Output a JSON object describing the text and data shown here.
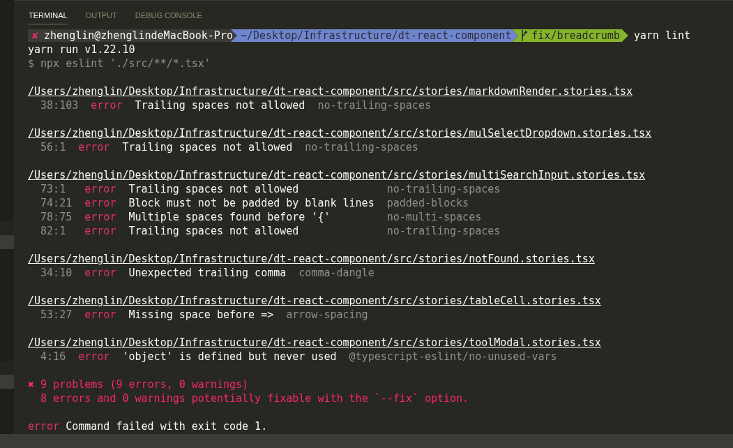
{
  "tabs": [
    {
      "label": "TERMINAL",
      "selected": true
    },
    {
      "label": "OUTPUT",
      "selected": false
    },
    {
      "label": "DEBUG CONSOLE",
      "selected": false
    }
  ],
  "prompt": {
    "status": "✘",
    "user": "zhenglin@zhenglindeMacBook-Pro",
    "path": "~/Desktop/Infrastructure/dt-react-component",
    "branch": "fix/breadcrumb",
    "command": "yarn lint"
  },
  "lines": [
    {
      "kind": "plain",
      "text": "yarn run v1.22.10"
    },
    {
      "kind": "dim",
      "text": "$ npx eslint './src/**/*.tsx'"
    }
  ],
  "files": [
    {
      "path": "/Users/zhenglin/Desktop/Infrastructure/dt-react-component/src/stories/markdownRender.stories.tsx",
      "problems": [
        {
          "location": "38:103",
          "severity": "error",
          "message": "Trailing spaces not allowed",
          "rule": "no-trailing-spaces"
        }
      ]
    },
    {
      "path": "/Users/zhenglin/Desktop/Infrastructure/dt-react-component/src/stories/mulSelectDropdown.stories.tsx",
      "problems": [
        {
          "location": "56:1",
          "severity": "error",
          "message": "Trailing spaces not allowed",
          "rule": "no-trailing-spaces"
        }
      ]
    },
    {
      "path": "/Users/zhenglin/Desktop/Infrastructure/dt-react-component/src/stories/multiSearchInput.stories.tsx",
      "problems": [
        {
          "location": "73:1",
          "severity": "error",
          "message": "Trailing spaces not allowed",
          "rule": "no-trailing-spaces"
        },
        {
          "location": "74:21",
          "severity": "error",
          "message": "Block must not be padded by blank lines",
          "rule": "padded-blocks"
        },
        {
          "location": "78:75",
          "severity": "error",
          "message": "Multiple spaces found before '{'",
          "rule": "no-multi-spaces"
        },
        {
          "location": "82:1",
          "severity": "error",
          "message": "Trailing spaces not allowed",
          "rule": "no-trailing-spaces"
        }
      ]
    },
    {
      "path": "/Users/zhenglin/Desktop/Infrastructure/dt-react-component/src/stories/notFound.stories.tsx",
      "problems": [
        {
          "location": "34:10",
          "severity": "error",
          "message": "Unexpected trailing comma",
          "rule": "comma-dangle"
        }
      ]
    },
    {
      "path": "/Users/zhenglin/Desktop/Infrastructure/dt-react-component/src/stories/tableCell.stories.tsx",
      "problems": [
        {
          "location": "53:27",
          "severity": "error",
          "message": "Missing space before =>",
          "rule": "arrow-spacing"
        }
      ]
    },
    {
      "path": "/Users/zhenglin/Desktop/Infrastructure/dt-react-component/src/stories/toolModal.stories.tsx",
      "problems": [
        {
          "location": "4:16",
          "severity": "error",
          "message": "'object' is defined but never used",
          "rule": "@typescript-eslint/no-unused-vars"
        }
      ]
    }
  ],
  "summary": {
    "icon": "✖",
    "text": "9 problems (9 errors, 0 warnings)",
    "detail": "8 errors and 0 warnings potentially fixable with the `--fix` option."
  },
  "footer": {
    "severity": "error",
    "text": "Command failed with exit code 1."
  }
}
